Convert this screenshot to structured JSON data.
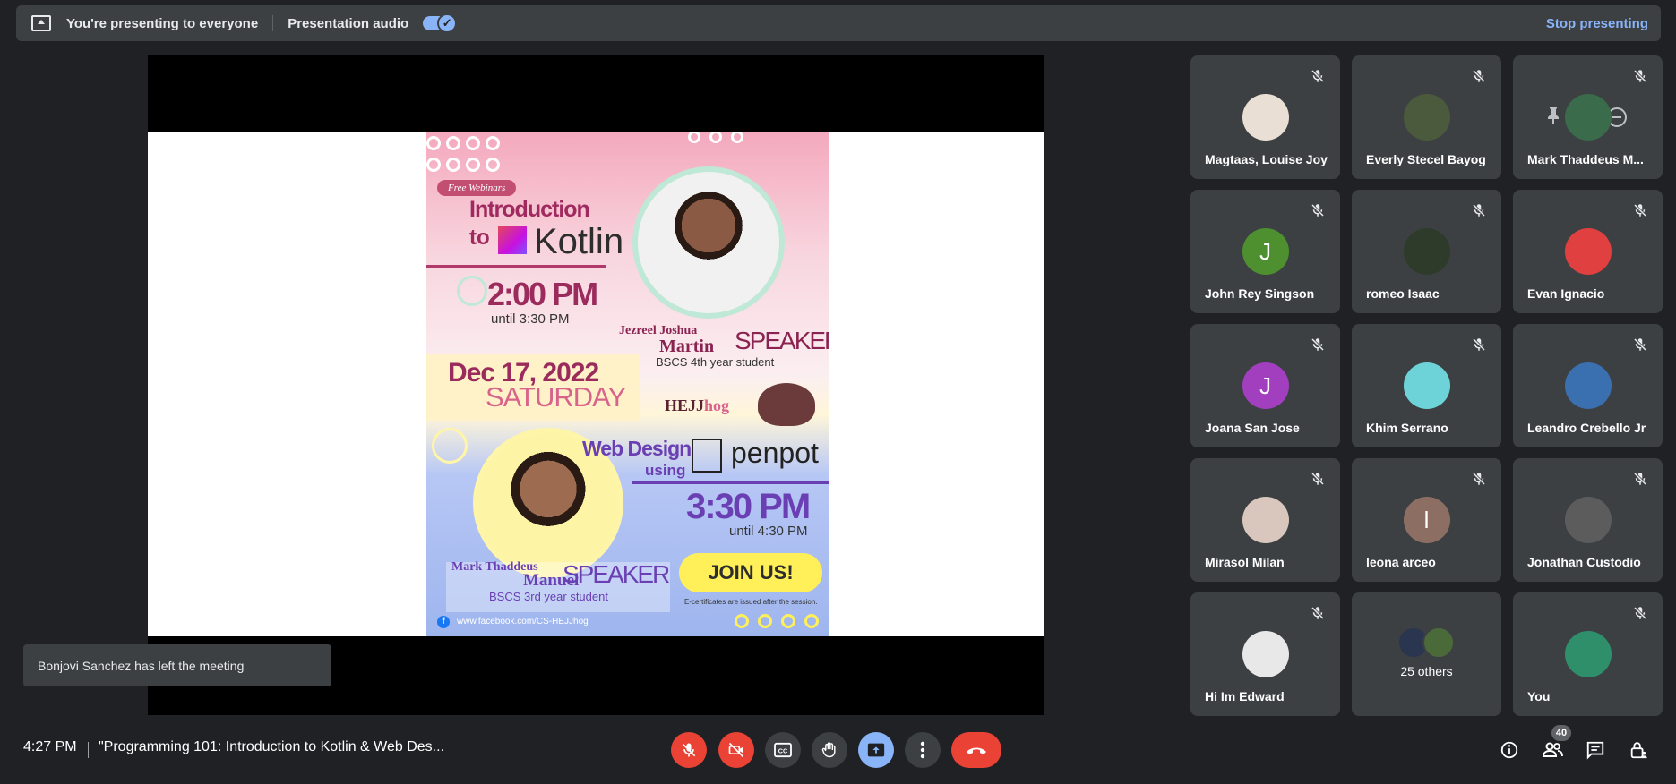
{
  "topbar": {
    "presenting_text": "You're presenting to everyone",
    "audio_label": "Presentation audio",
    "stop_label": "Stop presenting"
  },
  "slide": {
    "pill": "Free Webinars",
    "intro": "Introduction",
    "to": "to",
    "kotlin": "Kotlin",
    "time1": "2:00 PM",
    "until1": "until 3:30 PM",
    "speaker1_first": "Jezreel Joshua",
    "speaker1_last": "Martin",
    "speaker_label": "SPEAKER",
    "speaker1_year": "BSCS 4th year student",
    "date": "Dec 17, 2022",
    "day": "SATURDAY",
    "org_a": "HEJJ",
    "org_b": "hog",
    "web_design": "Web Design",
    "using": "using",
    "penpot": "penpot",
    "time2": "3:30 PM",
    "until2": "until 4:30 PM",
    "speaker2_first": "Mark Thaddeus",
    "speaker2_last": "Manuel",
    "speaker2_year": "BSCS 3rd year student",
    "join": "JOIN US!",
    "ecert": "E-certificates are issued after the session.",
    "facebook": "www.facebook.com/CS-HEJJhog"
  },
  "toast": "Bonjovi Sanchez has left the meeting",
  "participants": [
    {
      "name": "Magtaas, Louise Joy",
      "initial": "",
      "color": "#e9dfd5"
    },
    {
      "name": "Everly Stecel Bayog",
      "initial": "",
      "color": "#4b5a3c"
    },
    {
      "name": "Mark Thaddeus M...",
      "initial": "",
      "color": "#3a6b4a"
    },
    {
      "name": "John Rey Singson",
      "initial": "J",
      "color": "#4e8f2f"
    },
    {
      "name": "romeo Isaac",
      "initial": "",
      "color": "#2f3b2a"
    },
    {
      "name": "Evan Ignacio",
      "initial": "",
      "color": "#e04040"
    },
    {
      "name": "Joana San Jose",
      "initial": "J",
      "color": "#a13fbf"
    },
    {
      "name": "Khim Serrano",
      "initial": "",
      "color": "#6dd3d8"
    },
    {
      "name": "Leandro Crebello Jr",
      "initial": "",
      "color": "#3a6fb0"
    },
    {
      "name": "Mirasol Milan",
      "initial": "",
      "color": "#d9c7bd"
    },
    {
      "name": "leona arceo",
      "initial": "l",
      "color": "#8d6e63"
    },
    {
      "name": "Jonathan Custodio",
      "initial": "",
      "color": "#5c5c5c"
    },
    {
      "name": "Hi Im Edward",
      "initial": "",
      "color": "#e8e8e8"
    },
    {
      "name": "You",
      "initial": "",
      "color": "#2f8f6a"
    }
  ],
  "others": {
    "label": "25 others"
  },
  "bottombar": {
    "time": "4:27 PM",
    "meeting_title": "\"Programming 101: Introduction to Kotlin & Web Des...",
    "people_count": "40"
  },
  "colors": {
    "background": "#202124",
    "surface": "#3c4043",
    "accent": "#8ab4f8",
    "danger": "#ea4335"
  }
}
